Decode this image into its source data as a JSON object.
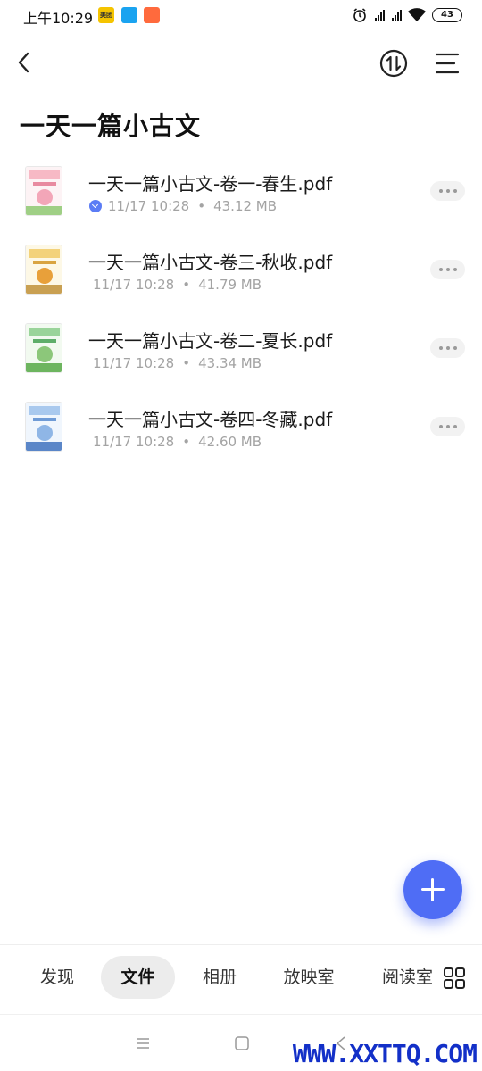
{
  "status_bar": {
    "time": "上午10:29",
    "app_badge": "美团",
    "battery": "43"
  },
  "header": {
    "title": "一天一篇小古文"
  },
  "files": [
    {
      "name": "一天一篇小古文-卷一-春生.pdf",
      "date": "11/17 10:28",
      "size": "43.12 MB",
      "downloaded": true,
      "cover_color": "#f7b9c5"
    },
    {
      "name": "一天一篇小古文-卷三-秋收.pdf",
      "date": "11/17 10:28",
      "size": "41.79 MB",
      "downloaded": false,
      "cover_color": "#f3d27a"
    },
    {
      "name": "一天一篇小古文-卷二-夏长.pdf",
      "date": "11/17 10:28",
      "size": "43.34 MB",
      "downloaded": false,
      "cover_color": "#9ad49a"
    },
    {
      "name": "一天一篇小古文-卷四-冬藏.pdf",
      "date": "11/17 10:28",
      "size": "42.60 MB",
      "downloaded": false,
      "cover_color": "#a9c9ee"
    }
  ],
  "meta_separator": "•",
  "bottom_nav": {
    "tabs": [
      "发现",
      "文件",
      "相册",
      "放映室",
      "阅读室"
    ],
    "active": "文件"
  },
  "colors": {
    "accent": "#4f6df5",
    "meta_text": "#a3a3a3"
  },
  "watermark": "WWW.XXTTQ.COM"
}
